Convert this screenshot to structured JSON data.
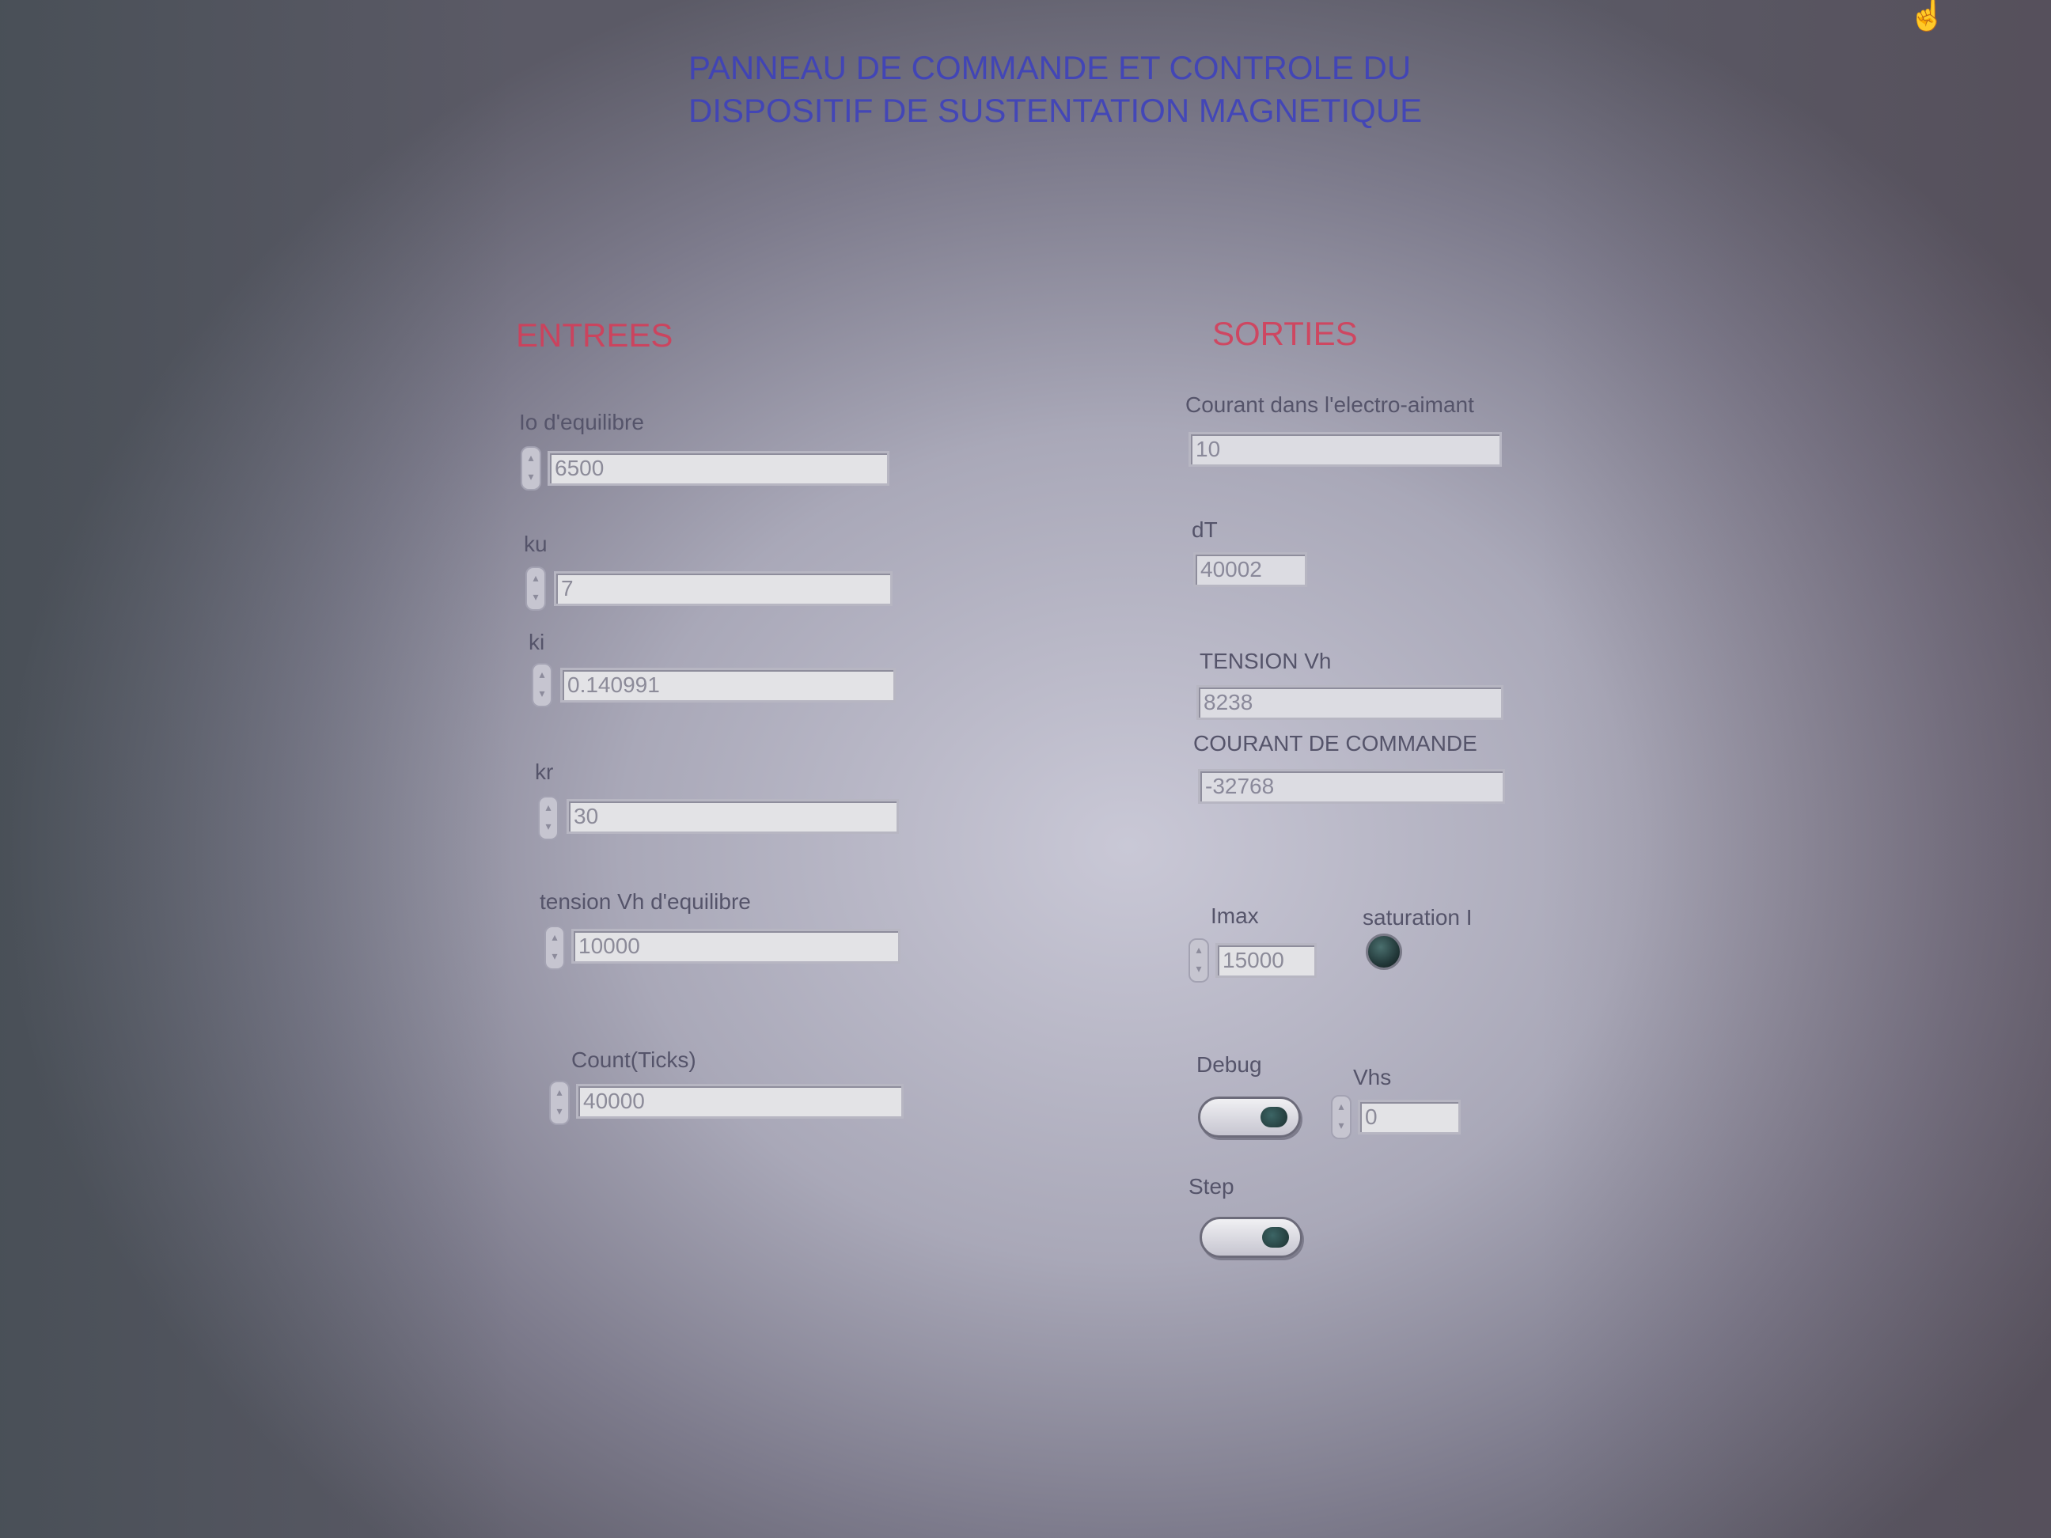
{
  "title": {
    "line1": "PANNEAU DE COMMANDE ET CONTROLE DU",
    "line2": "DISPOSITIF DE SUSTENTATION MAGNETIQUE"
  },
  "inputs": {
    "heading": "ENTREES",
    "io_equilibre": {
      "label": "Io d'equilibre",
      "value": "6500"
    },
    "ku": {
      "label": "ku",
      "value": "7"
    },
    "ki": {
      "label": "ki",
      "value": "0.140991"
    },
    "kr": {
      "label": "kr",
      "value": "30"
    },
    "tension_vh_equilibre": {
      "label": "tension Vh d'equilibre",
      "value": "10000"
    },
    "count_ticks": {
      "label": "Count(Ticks)",
      "value": "40000"
    }
  },
  "outputs": {
    "heading": "SORTIES",
    "courant_electro_aimant": {
      "label": "Courant dans l'electro-aimant",
      "value": "10"
    },
    "dt": {
      "label": "dT",
      "value": "40002"
    },
    "tension_vh": {
      "label": "TENSION Vh",
      "value": "8238"
    },
    "courant_commande": {
      "label": "COURANT DE COMMANDE",
      "value": "-32768"
    },
    "imax": {
      "label": "Imax",
      "value": "15000"
    },
    "saturation_i": {
      "label": "saturation I",
      "state": "off"
    },
    "debug": {
      "label": "Debug",
      "state": "off"
    },
    "vhs": {
      "label": "Vhs",
      "value": "0"
    },
    "step": {
      "label": "Step",
      "state": "off"
    }
  },
  "icons": {
    "spinner": "up-down-arrows-icon",
    "cursor": "hand-pointer-icon",
    "led": "led-indicator-icon",
    "toggle": "toggle-switch-icon"
  },
  "colors": {
    "title": "#3b3fc0",
    "section_heading": "#d83a56",
    "label": "#55546a",
    "panel_background": "#b6b5c4",
    "led_off": "#23393a"
  }
}
